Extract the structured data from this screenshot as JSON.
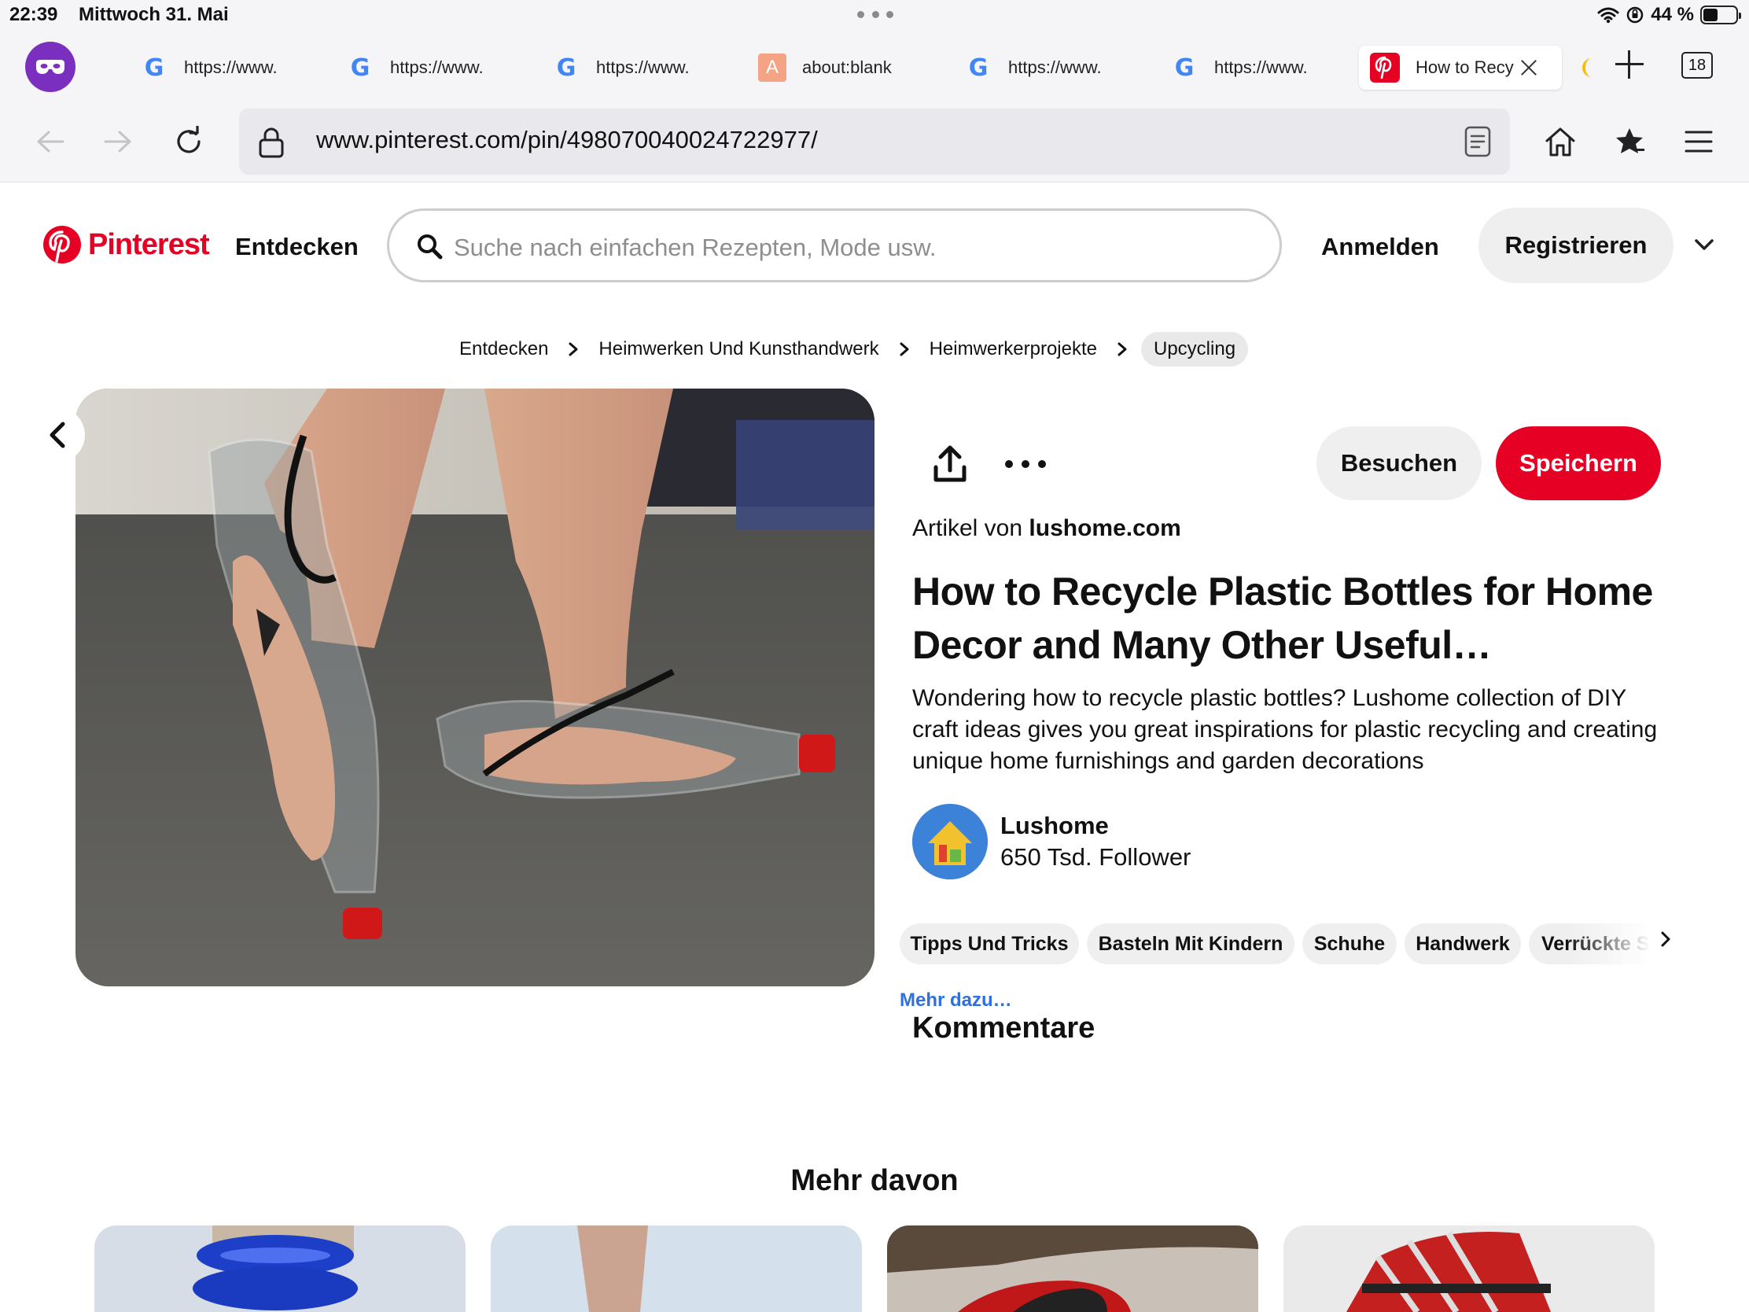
{
  "status_bar": {
    "time": "22:39",
    "date": "Mittwoch 31. Mai",
    "battery": "44 %",
    "battery_level": 0.44
  },
  "tabs": [
    {
      "favicon": "google-icon",
      "label": "https://www."
    },
    {
      "favicon": "google-icon",
      "label": "https://www."
    },
    {
      "favicon": "google-icon",
      "label": "https://www."
    },
    {
      "favicon": "letter-a-icon",
      "favicon_text": "A",
      "label": "about:blank"
    },
    {
      "favicon": "google-icon",
      "label": "https://www."
    },
    {
      "favicon": "google-icon",
      "label": "https://www."
    },
    {
      "favicon": "pinterest-icon",
      "label": "How to Recy",
      "active": true
    }
  ],
  "tab_count": "18",
  "toolbar": {
    "url": "www.pinterest.com/pin/498070040024722977/"
  },
  "header": {
    "logo_text": "Pinterest",
    "nav_label": "Entdecken",
    "search_placeholder": "Suche nach einfachen Rezepten, Mode usw.",
    "login_label": "Anmelden",
    "register_label": "Registrieren"
  },
  "breadcrumb": [
    "Entdecken",
    "Heimwerken Und Kunsthandwerk",
    "Heimwerkerprojekte",
    "Upcycling"
  ],
  "pin": {
    "visit_label": "Besuchen",
    "save_label": "Speichern",
    "article_prefix": "Artikel von",
    "article_source": "lushome.com",
    "title": "How to Recycle Plastic Bottles for Home Decor and Many Other Useful…",
    "description": "Wondering how to recycle plastic bottles? Lushome collection of DIY craft ideas gives you great inspirations for plastic recycling and creating unique home furnishings and garden decorations",
    "creator": {
      "name": "Lushome",
      "followers": "650 Tsd. Follower"
    },
    "tags": [
      "Tipps Und Tricks",
      "Basteln Mit Kindern",
      "Schuhe",
      "Handwerk",
      "Verrückte Schuhe"
    ],
    "more_link": "Mehr dazu…",
    "comments_heading": "Kommentare"
  },
  "more_section": {
    "title": "Mehr davon"
  },
  "colors": {
    "brand": "#e60023",
    "link": "#2f6fdf",
    "private_mode": "#7b2fbe",
    "pill_bg": "#efefef"
  }
}
